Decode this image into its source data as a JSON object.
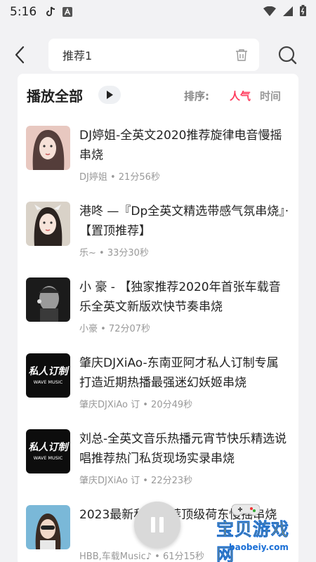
{
  "status": {
    "time": "5:16"
  },
  "search": {
    "query": "推荐1"
  },
  "header": {
    "play_all": "播放全部",
    "sort_label": "排序:",
    "sort_hot": "人气",
    "sort_time": "时间"
  },
  "colors": {
    "accent": "#ff3b5c",
    "card_bg": "#ffffff",
    "page_bg": "#f2f2f4"
  },
  "items": [
    {
      "title": "DJ婷姐-全英文2020推荐旋律电音慢摇串烧",
      "meta": "DJ婷姐 • 21分56秒"
    },
    {
      "title": "港咚 —『Dp全英文精选带感气氛串烧』·【置顶推荐】",
      "meta": "乐~ • 33分30秒"
    },
    {
      "title": "小 豪 - 【独家推荐2020年首张车载音乐全英文新版欢快节奏串烧",
      "meta": "小豪 • 72分07秒"
    },
    {
      "title": "肇庆DJXiAo-东南亚阿才私人订制专属打造近期热播最强迷幻妖姬串烧",
      "meta": "肇庆DJXiAo 订 • 20分49秒"
    },
    {
      "title": "刘总-全英文音乐热播元宵节快乐精选说唱推荐热门私货现场实录串烧",
      "meta": "肇庆DJXiAo 订 • 22分23秒"
    },
    {
      "title": "2023最新私家推荐顶级荷东慢摇串烧",
      "meta": "HBB,车载Music♪ • 61分15秒"
    }
  ],
  "watermark": {
    "name": "宝贝游戏网",
    "url": "baobeiy.com"
  }
}
